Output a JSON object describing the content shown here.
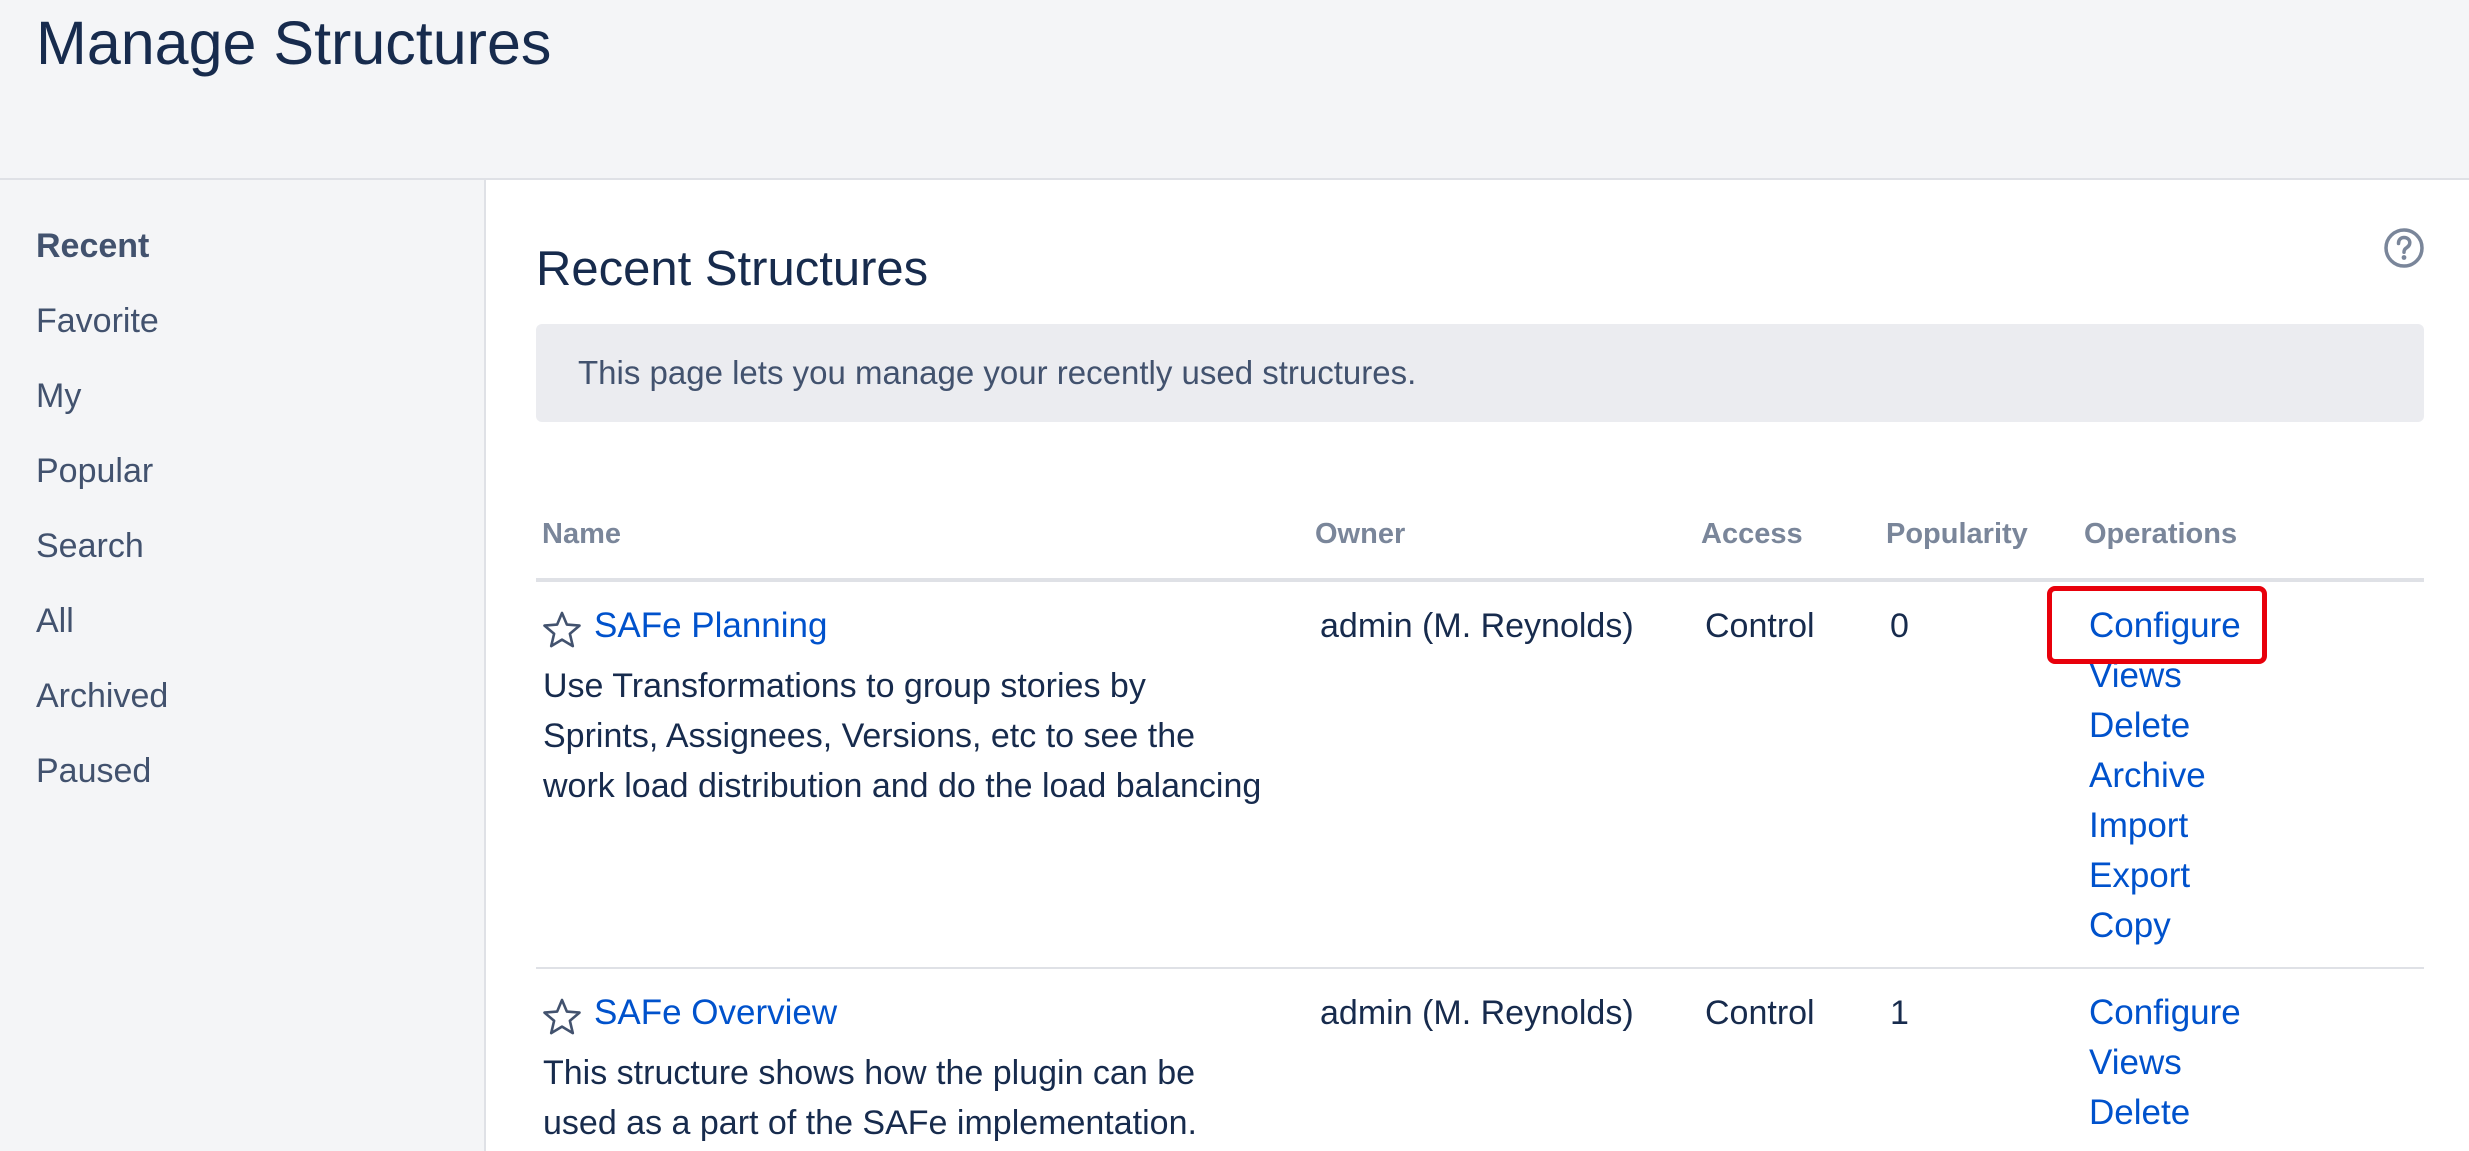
{
  "header": {
    "title": "Manage Structures"
  },
  "sidebar": {
    "items": [
      {
        "label": "Recent",
        "active": true
      },
      {
        "label": "Favorite"
      },
      {
        "label": "My"
      },
      {
        "label": "Popular"
      },
      {
        "label": "Search"
      },
      {
        "label": "All"
      },
      {
        "label": "Archived"
      },
      {
        "label": "Paused"
      }
    ]
  },
  "main": {
    "title": "Recent Structures",
    "help_icon": "question-circle-icon",
    "info": "This page lets you manage your recently used structures.",
    "table": {
      "columns": [
        "Name",
        "Owner",
        "Access",
        "Popularity",
        "Operations"
      ],
      "rows": [
        {
          "name": "SAFe Planning",
          "description": "Use Transformations to group stories by Sprints, Assignees, Versions, etc to see the work load distribution and do the load balancing",
          "owner": "admin (M. Reynolds)",
          "access": "Control",
          "popularity": "0",
          "operations": [
            "Configure",
            "Views",
            "Delete",
            "Archive",
            "Import",
            "Export",
            "Copy"
          ]
        },
        {
          "name": "SAFe Overview",
          "description": "This structure shows how the plugin can be used as a part of the SAFe implementation.",
          "owner": "admin (M. Reynolds)",
          "access": "Control",
          "popularity": "1",
          "operations": [
            "Configure",
            "Views",
            "Delete"
          ]
        }
      ]
    }
  },
  "colors": {
    "link": "#0052cc",
    "highlight": "#e8000b",
    "text": "#172b4d",
    "muted": "#7a869a"
  }
}
